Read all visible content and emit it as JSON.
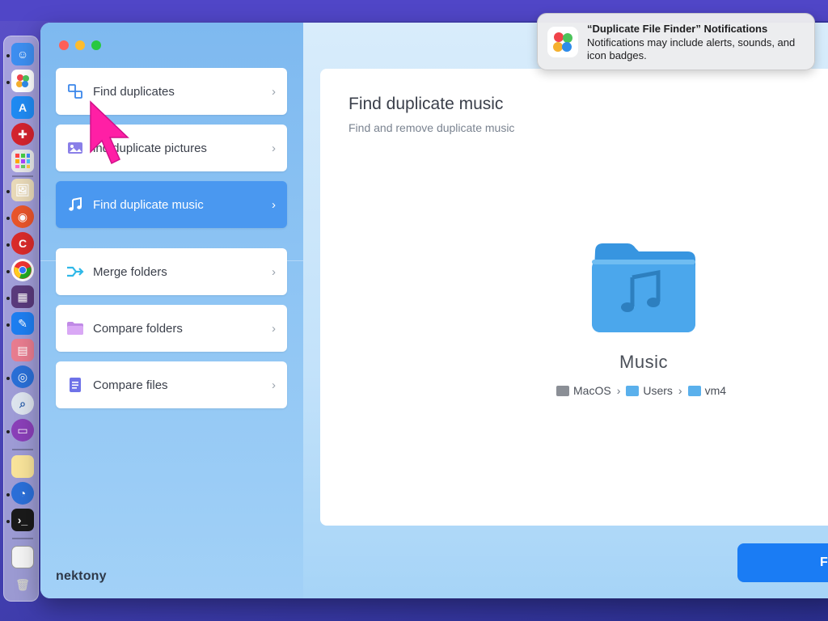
{
  "sidebar": {
    "items": [
      {
        "label": "Find duplicates",
        "icon": "duplicates-icon",
        "active": false
      },
      {
        "label": "ind duplicate pictures",
        "icon": "pictures-icon",
        "active": false
      },
      {
        "label": "Find duplicate music",
        "icon": "music-note-icon",
        "active": true
      },
      {
        "label": "Merge folders",
        "icon": "merge-arrow-icon",
        "active": false
      },
      {
        "label": "Compare folders",
        "icon": "folder-icon",
        "active": false
      },
      {
        "label": "Compare files",
        "icon": "file-icon",
        "active": false
      }
    ],
    "chevron": "›",
    "brand": "nektony"
  },
  "main": {
    "title": "Find duplicate music",
    "subtitle": "Find and remove duplicate music",
    "folder_name": "Music",
    "path": [
      {
        "label": "MacOS",
        "icon": "drive-icon"
      },
      {
        "label": "Users",
        "icon": "folder-icon"
      },
      {
        "label": "vm4",
        "icon": "folder-icon"
      }
    ],
    "path_separator": "›",
    "find_button": "Fi"
  },
  "notification": {
    "title": "“Duplicate File Finder” Notifications",
    "body": "Notifications may include alerts, sounds, and icon badges."
  },
  "colors": {
    "accent": "#4a98f0",
    "button": "#1a7cf4",
    "cursor": "#ff1fa5",
    "folder": "#4ba7ec"
  }
}
